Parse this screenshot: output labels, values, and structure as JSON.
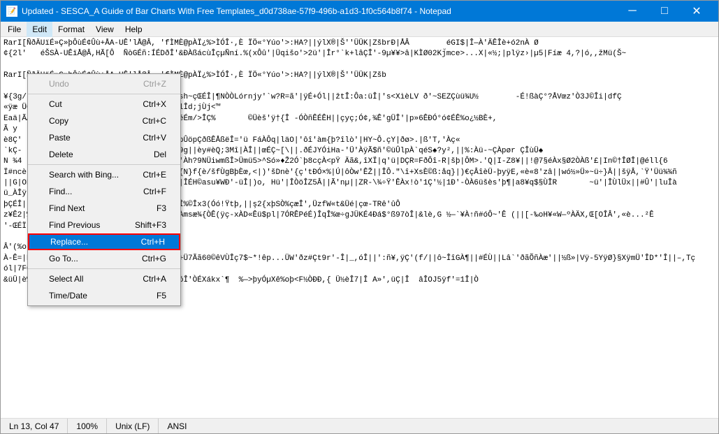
{
  "titleBar": {
    "icon": "📝",
    "title": "Updated - SESCA_A Guide of Bar Charts With Free Templates_d0d738ae-57f9-496b-a1d3-1f0c564b8f74 - Notepad",
    "minimizeLabel": "─",
    "maximizeLabel": "□",
    "closeLabel": "✕"
  },
  "menuBar": {
    "items": [
      "File",
      "Edit",
      "Format",
      "View",
      "Help"
    ]
  },
  "editMenu": {
    "items": [
      {
        "label": "Undo",
        "shortcut": "Ctrl+Z",
        "disabled": true
      },
      {
        "label": "separator"
      },
      {
        "label": "Cut",
        "shortcut": "Ctrl+X"
      },
      {
        "label": "Copy",
        "shortcut": "Ctrl+C"
      },
      {
        "label": "Paste",
        "shortcut": "Ctrl+V"
      },
      {
        "label": "Delete",
        "shortcut": "Del"
      },
      {
        "label": "separator"
      },
      {
        "label": "Search with Bing...",
        "shortcut": "Ctrl+E"
      },
      {
        "label": "Find...",
        "shortcut": "Ctrl+F"
      },
      {
        "label": "Find Next",
        "shortcut": "F3"
      },
      {
        "label": "Find Previous",
        "shortcut": "Shift+F3"
      },
      {
        "label": "Replace...",
        "shortcut": "Ctrl+H",
        "highlighted": true
      },
      {
        "label": "Go To...",
        "shortcut": "Ctrl+G"
      },
      {
        "label": "separator"
      },
      {
        "label": "Select All",
        "shortcut": "Ctrl+A"
      },
      {
        "label": "Time/Date",
        "shortcut": "F5"
      }
    ]
  },
  "editorContent": "RarI[ÑðÄUïÉ»Ç»þÔùÉ¢Ûù+ÅA-UÊ'lÅ@Â, 'fÌMÈ@pÀÏ¿%>ÌÓÎ·,È ÏÖ«°Yúo'>:HA?||ýlX®|Š''ÜÜK|ZšbrÐ|ÅÂ        éGI$|Î—À'ÄÊÎè+ó2nÀ Ø\n¢{2l'   éŠSÀ-UÊïÅ@Â,HÃ[Ô  ÑòGÉñ:ÍÉDðÎ'&ÐÀßácùÎçµÑní.%(xÔû'|Üqišo'>2ü'|Îr°`k+lâÇÎ'-9µ¥¥>â|KÌØ02Kj̈mce>...X|«½;|plÿz›|µ5|Fíæ 4,?|ó,,žMü(Š~\n\nRarI[ÑðÄUïÉ»Ç»þÔùÉ¢Ûù+ÅA-UÊ'lÅ@Â, 'fÌMÈ@pÀÏ¿%>ÌÓÎ·,È ÏÖ«°Yúo'>:HA?||ýlX®|Š''ÜÜK|Zšb\n\n¥{3g/   éŠSÀ-UÊïÅ@Â,HÃ[Ô  8'½tU-'³|n5.sh~çŒÉÎ|¶NÒÒLórnjy'`w?R=ã'|ÿÉ+Ól||žtÎ:Ôa:üÎ|'s<XìèLV ð'~SEZÇùü¾U½        -É!ßàÇ°?ÅVœz'Ò3J©Îi|dfÇ\n«ÿæ ÜO-Ùúçá¶évGO|#1.ÉF,Ÿdèü»||2.!CeFÓplÎd;jÙj<™\nEaä|ÃÀ  Ýyx_|çöAS÷'Jæ'ÍÿÌ#,ã-ÒdŽ||ÎÉO~éÉm/>ÎÇ%       ©Üèš'ÿ†{Î -ÓÒñÊÉÊH||çyç;Ó¢,¾Ê'gÜÎ'|p»6ÊÐÓ°ó¢ÉÊ%o¿½BÈ+,\nÃ y\nè8Ç'   P|TÎçs«~'(Q%Ü6       c'w_,Î—Ú|»pÛöpÇðßÊÅßëÎ='ü FáÀÔq|läO|'ôî'àm{þ?îlò'|HY~Ô.çY|ðø>.|ß'T,'Àç«\n`kÇ-  ê8Çò   ýðSíknßð{%ôÎÀcèÇ'|ÎÞÊ#q|Ç9g||èy#èQ;3Mî|ÀÎ||œÉÇ~[\\||.ðÉJYÓiHa-'Ü'ÀÿÃ$ñ'©üÛlpÀ`qéS♠?y²,||%:Àü-~ÇÀpør ÇÎùÜ♠\nN ¾4  Ú|çIFS_,Ñfð|,¶D.10fÌnGð ÎÛ'wânÎÛ'Àh?9NÜiwmßÎ>Ümü5>^Só»♦Ž2Ó`þ8cçÀ<pŸ Äã&,îXÏ|q'ü|DÇR=FðÔî-R|šþ|ÔM>.'Q|I-Z8¥||!@7§éÀx§Ø2ÒÀß'£|In©†ÎØÎ|@éll{6\nÏ#ncè{ÔœÔsy6K||ÎÔ-Â|ÜU%ðÎ'\\Â|6||R(6Ô÷%{N}f{è/šfÙgBþÈœ,<|)'šDnè'{ç'tÐÓ×%|Ú|ôÒw'ÊŽ||ÎÔ.\"\\î+XsÈ©ß:åq}|)€çÂîèÜ-þyÿE,«è«8'zâ||wó½»Ü»~ü÷}Â||šÿÂ,`Ÿ'Üü¾¾ñ\n||G|OÉÜ'½y||àwþNÀsohDßþ¾%ÎÐ||NÔè«°ê÷Ò||ÎÉH©asu¥WÐ'-üÎ|)o, Hü'|ÎÒöÎZ5Â||Ã'nµ||ZR-\\¾÷Ÿ'ÊÀx!ò'1Ç'½|1Ð'-ÒÀ6üšès'þ¶|a8¥q$§ÙÎR       ~ü'|ÎÙlÜx||#Û'|luÎà\nü_ÀÎÿ|VùHqóÿ'þ|\nþÇÉÎ||8ŽãÀÊÀÉQ'·çz«||fó@µ8ŽçxŸ|\\k9,tÉÀÎ%©Îx3(Óó!Ÿtþ,||ş2{xþSÒ%çæÎ',ÜzfW«t&Üé|çœ-TRê'ûÔ\nz¥Ê2|%Št'GrÎÜ|\\Àþ3Ê,ÎðÎ|%o5QŽ>h.µ?ðš.NÀmsæ¾{ÒÊ(ÿç-xÀD«Êü$pl|7ÓRÊPéÉ)ÎqÎ%œ÷gJÜKÉ4Ðá$°ß97òÎ|&lè,G ½—`¥À↑ñ#óÔ~'Ê (||[-‰oH¥«W—ºÀÄX,Œ[OÎÂ',«è...²Ê\n'-ŒÉÏ'1Ï<ÜÎ½ÇÒ8ÿ\n                6ü'üþ(ŒÎ|%š)\nÂ'(%o*\nÀ-Ê=|Év,'ÿT'|{E-X`âün`ê||?[R½Æhð<5te¾4÷Ü7Ãã60©êVÙÎç7$~*!êp...ÜW'ðz#Çt9r'-Î|_,óÎ||':ñ¥,ÿÇ'(f/||ô~ÎîGÀ¶||#ÉÙ||Lâ`'ðãÕñÀæ'||½ß»|Vÿ-5YÿØ}§XÿmÜ'ÎD*'Î||–,Tç\nól|7FÔÞÉ>13Ÿ_À'|\n&üÜ|è%o'Ùþ,wK¥â'—æš@ÜoÒ,'ÎE»!bHM_©`ð=[óÎ'ÒÉXákx`¶  %—>þyÓµXê%oþ<F½ÒÐÐ,{ Ü½èÎ7|Î A»',üÇ|Î  âÎOJ5ÿf'=1Î|Ò",
  "statusBar": {
    "position": "Ln 13, Col 47",
    "zoom": "100%",
    "lineEnding": "Unix (LF)",
    "encoding": "ANSI"
  }
}
